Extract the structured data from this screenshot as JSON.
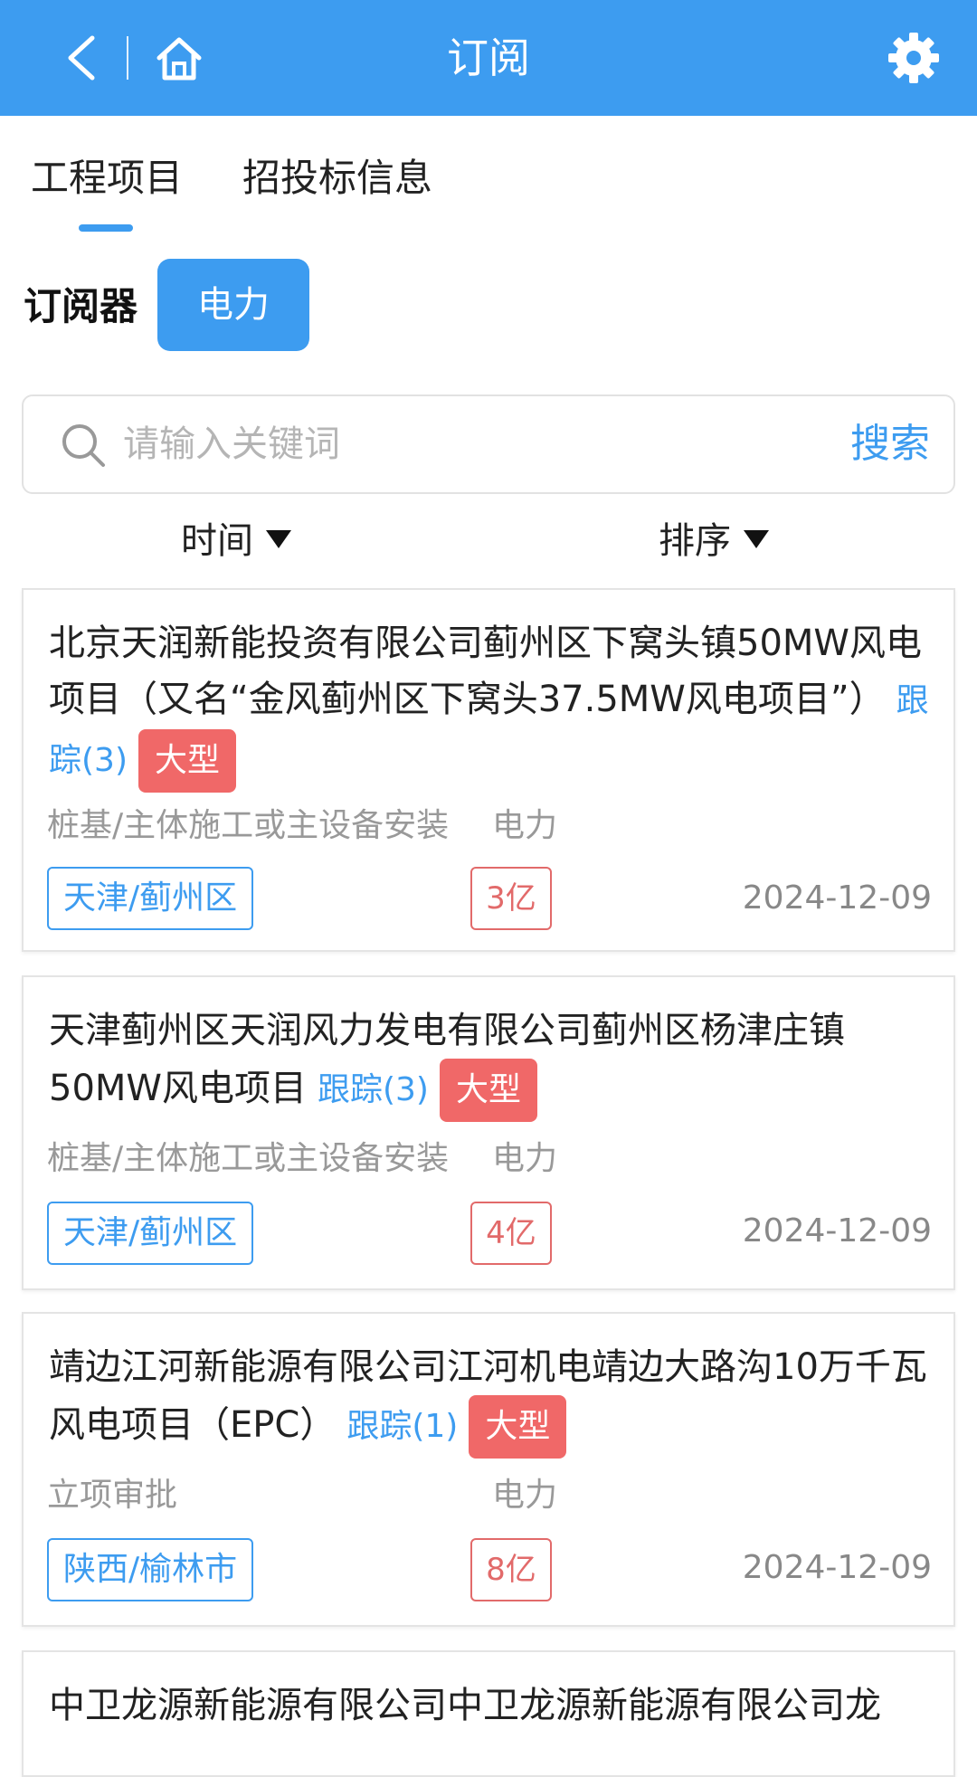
{
  "header": {
    "title": "订阅",
    "back_icon": "chevron-left-icon",
    "home_icon": "home-icon",
    "settings_icon": "gear-icon"
  },
  "tabs": [
    {
      "label": "工程项目",
      "active": true
    },
    {
      "label": "招投标信息",
      "active": false
    }
  ],
  "subscriber": {
    "label": "订阅器",
    "chip": "电力"
  },
  "search": {
    "placeholder": "请输入关键词",
    "button_label": "搜索"
  },
  "filters": {
    "time_label": "时间",
    "sort_label": "排序"
  },
  "cards": [
    {
      "title": "北京天润新能投资有限公司蓟州区下窝头镇50MW风电项目（又名“金风蓟州区下窝头37.5MW风电项目”）",
      "track": "跟踪(3)",
      "badge": "大型",
      "stage": "桩基/主体施工或主设备安装",
      "industry": "电力",
      "region": "天津/蓟州区",
      "amount": "3亿",
      "date": "2024-12-09"
    },
    {
      "title": "天津蓟州区天润风力发电有限公司蓟州区杨津庄镇50MW风电项目",
      "track": "跟踪(3)",
      "badge": "大型",
      "stage": "桩基/主体施工或主设备安装",
      "industry": "电力",
      "region": "天津/蓟州区",
      "amount": "4亿",
      "date": "2024-12-09"
    },
    {
      "title": "靖边江河新能源有限公司江河机电靖边大路沟10万千瓦风电项目（EPC）",
      "track": "跟踪(1)",
      "badge": "大型",
      "stage": "立项审批",
      "industry": "电力",
      "region": "陕西/榆林市",
      "amount": "8亿",
      "date": "2024-12-09"
    },
    {
      "title": "中卫龙源新能源有限公司中卫龙源新能源有限公司龙"
    }
  ],
  "colors": {
    "accent": "#3d9cf0",
    "badge": "#f06868",
    "amount": "#e26a6a"
  }
}
